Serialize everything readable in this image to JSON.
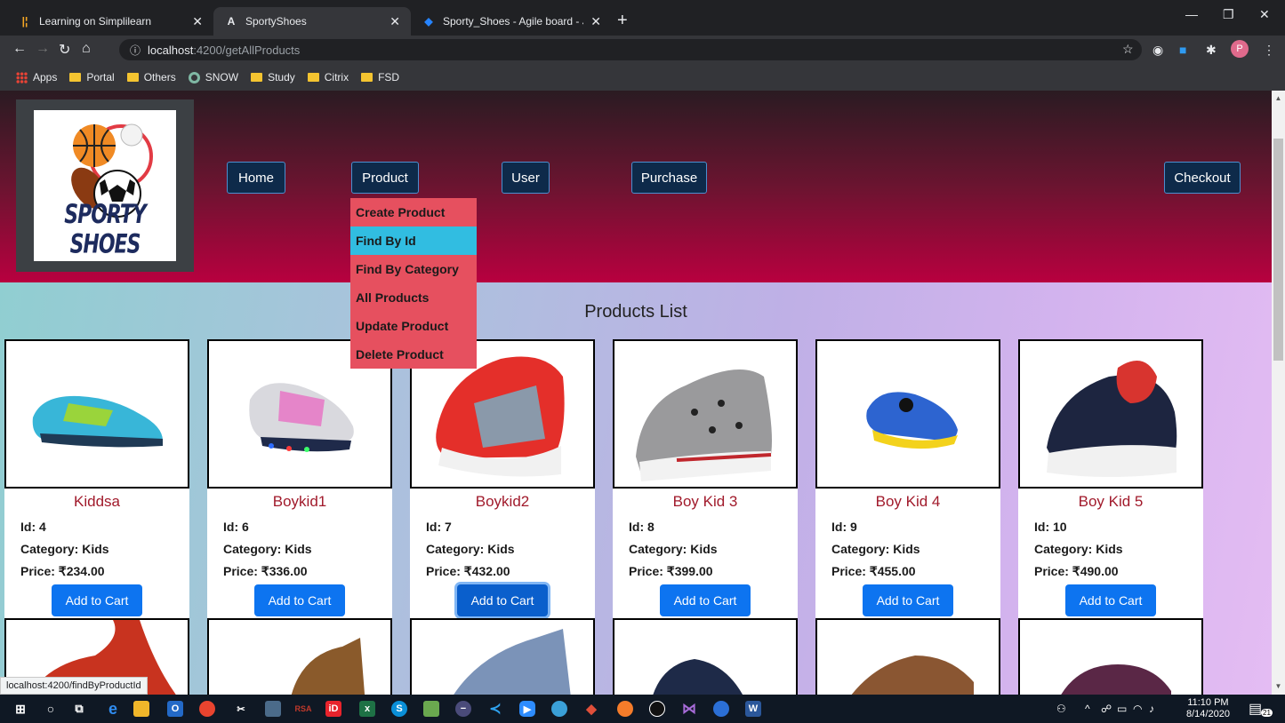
{
  "browser": {
    "tabs": [
      {
        "title": "Learning on Simplilearn",
        "icon": "simplilearn-icon",
        "active": false
      },
      {
        "title": "SportyShoes",
        "icon": "angular-icon",
        "active": true
      },
      {
        "title": "Sporty_Shoes - Agile board - Jira",
        "icon": "jira-icon",
        "active": false
      }
    ],
    "url_host": "localhost",
    "url_path": ":4200/getAllProducts",
    "bookmarks": [
      "Apps",
      "Portal",
      "Others",
      "SNOW",
      "Study",
      "Citrix",
      "FSD"
    ],
    "profile_initial": "P",
    "status_url": "localhost:4200/findByProductId"
  },
  "site": {
    "logo_text": "SPORTY SHOES",
    "nav": {
      "home": "Home",
      "product": "Product",
      "user": "User",
      "purchase": "Purchase",
      "checkout": "Checkout"
    },
    "product_menu": [
      "Create Product",
      "Find By Id",
      "Find By Category",
      "All Products",
      "Update Product",
      "Delete Product"
    ],
    "product_menu_highlighted": "Find By Id",
    "list_title": "Products List",
    "add_to_cart_label": "Add to Cart",
    "products": [
      {
        "name": "Kiddsa",
        "id": "Id: 4",
        "category": "Category: Kids",
        "price": "Price: ₹234.00"
      },
      {
        "name": "Boykid1",
        "id": "Id: 6",
        "category": "Category: Kids",
        "price": "Price: ₹336.00"
      },
      {
        "name": "Boykid2",
        "id": "Id: 7",
        "category": "Category: Kids",
        "price": "Price: ₹432.00"
      },
      {
        "name": "Boy Kid 3",
        "id": "Id: 8",
        "category": "Category: Kids",
        "price": "Price: ₹399.00"
      },
      {
        "name": "Boy Kid 4",
        "id": "Id: 9",
        "category": "Category: Kids",
        "price": "Price: ₹455.00"
      },
      {
        "name": "Boy Kid 5",
        "id": "Id: 10",
        "category": "Category: Kids",
        "price": "Price: ₹490.00"
      }
    ]
  },
  "taskbar": {
    "time": "11:10 PM",
    "date": "8/14/2020",
    "notification_count": "21"
  },
  "colors": {
    "header_top": "#2a1b22",
    "header_bottom": "#b8003f",
    "nav_button": "#0e2a4a",
    "dropdown_bg": "#e6505f",
    "dropdown_hover": "#31bde1",
    "add_to_cart": "#0d74f0",
    "product_name": "#a11a2b"
  }
}
